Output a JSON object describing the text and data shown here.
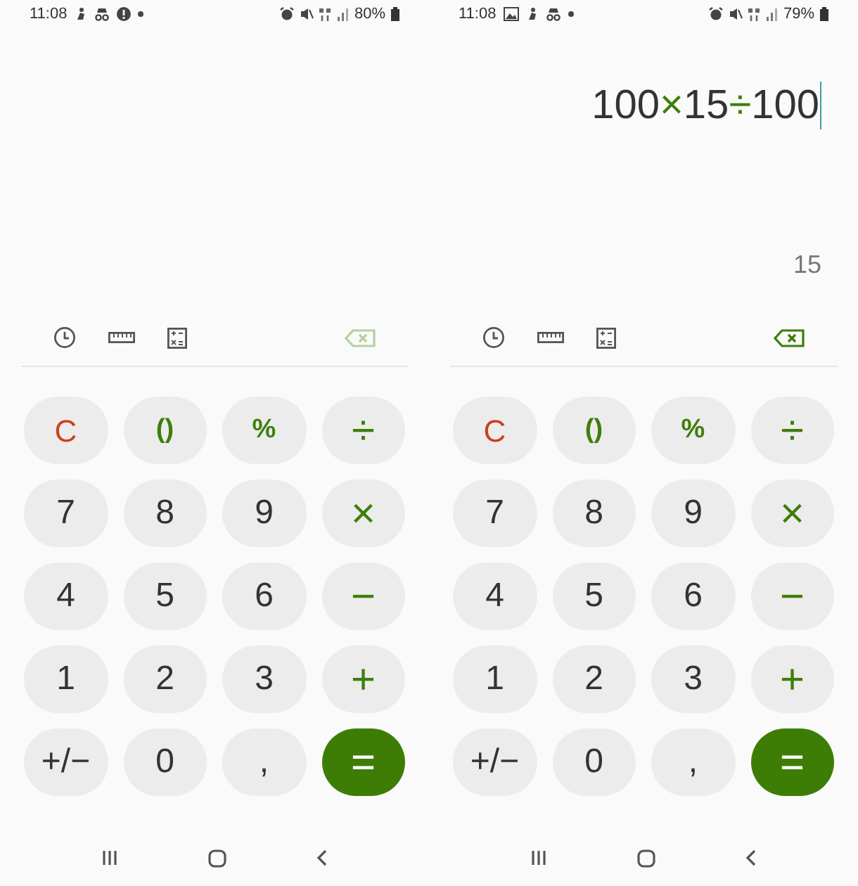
{
  "screens": [
    {
      "status_bar": {
        "time": "11:08",
        "notifications": [
          {
            "kind": "figure"
          },
          {
            "kind": "spy"
          },
          {
            "kind": "alert"
          },
          {
            "kind": "dot"
          }
        ],
        "battery": "80%"
      },
      "backspace_enabled": false,
      "keys": [
        {
          "label": "C",
          "kind": "clear"
        },
        {
          "label": "()",
          "kind": "function"
        },
        {
          "label": "%",
          "kind": "function"
        },
        {
          "label": "÷",
          "kind": "operator"
        },
        {
          "label": "7",
          "kind": "digit"
        },
        {
          "label": "8",
          "kind": "digit"
        },
        {
          "label": "9",
          "kind": "digit"
        },
        {
          "label": "×",
          "kind": "operator"
        },
        {
          "label": "4",
          "kind": "digit"
        },
        {
          "label": "5",
          "kind": "digit"
        },
        {
          "label": "6",
          "kind": "digit"
        },
        {
          "label": "−",
          "kind": "operator"
        },
        {
          "label": "1",
          "kind": "digit"
        },
        {
          "label": "2",
          "kind": "digit"
        },
        {
          "label": "3",
          "kind": "digit"
        },
        {
          "label": "+",
          "kind": "operator"
        },
        {
          "label": "+/−",
          "kind": "digit"
        },
        {
          "label": "0",
          "kind": "digit"
        },
        {
          "label": ",",
          "kind": "digit"
        },
        {
          "label": "=",
          "kind": "equals"
        }
      ]
    },
    {
      "status_bar": {
        "time": "11:08",
        "notifications": [
          {
            "kind": "picture"
          },
          {
            "kind": "figure"
          },
          {
            "kind": "spy"
          },
          {
            "kind": "dot"
          }
        ],
        "battery": "79%"
      },
      "expression": [
        {
          "text": "100",
          "kind": "number"
        },
        {
          "text": "×",
          "kind": "operator"
        },
        {
          "text": "15",
          "kind": "number"
        },
        {
          "text": "÷",
          "kind": "operator"
        },
        {
          "text": "100",
          "kind": "number"
        }
      ],
      "result": "15",
      "backspace_enabled": true,
      "keys": [
        {
          "label": "C",
          "kind": "clear"
        },
        {
          "label": "()",
          "kind": "function"
        },
        {
          "label": "%",
          "kind": "function"
        },
        {
          "label": "÷",
          "kind": "operator"
        },
        {
          "label": "7",
          "kind": "digit"
        },
        {
          "label": "8",
          "kind": "digit"
        },
        {
          "label": "9",
          "kind": "digit"
        },
        {
          "label": "×",
          "kind": "operator"
        },
        {
          "label": "4",
          "kind": "digit"
        },
        {
          "label": "5",
          "kind": "digit"
        },
        {
          "label": "6",
          "kind": "digit"
        },
        {
          "label": "−",
          "kind": "operator"
        },
        {
          "label": "1",
          "kind": "digit"
        },
        {
          "label": "2",
          "kind": "digit"
        },
        {
          "label": "3",
          "kind": "digit"
        },
        {
          "label": "+",
          "kind": "operator"
        },
        {
          "label": "+/−",
          "kind": "digit"
        },
        {
          "label": "0",
          "kind": "digit"
        },
        {
          "label": ",",
          "kind": "digit"
        },
        {
          "label": "=",
          "kind": "equals"
        }
      ]
    }
  ]
}
